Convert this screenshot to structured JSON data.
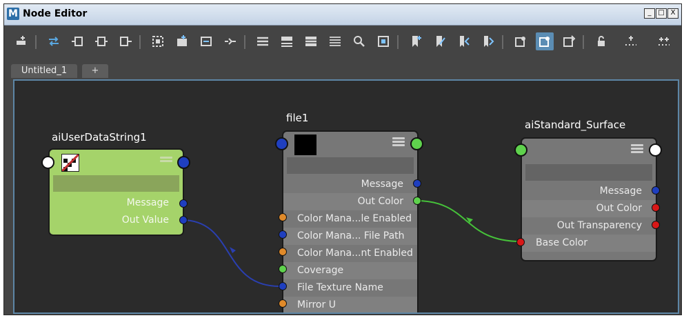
{
  "window": {
    "title": "Node Editor",
    "app_icon_letter": "M",
    "controls": [
      "_",
      "□",
      "X"
    ]
  },
  "tabs": [
    {
      "label": "Untitled_1"
    },
    {
      "label": "+"
    }
  ],
  "toolbar_icons": [
    "add-node-icon",
    "swap-icon",
    "input-connections-icon",
    "io-connections-icon",
    "output-connections-icon",
    "frame-all-icon",
    "frame-selection-icon",
    "clear-graph-icon",
    "layout-icon",
    "simple-mode-icon",
    "connected-mode-icon",
    "full-mode-icon",
    "custom-mode-icon",
    "search-icon",
    "snapshot-icon",
    "bookmark-add-icon",
    "bookmark-edit-icon",
    "bookmark-prev-icon",
    "bookmark-next-icon",
    "graph-settings-icon",
    "graph-settings-active-icon",
    "toggle-attr-icon",
    "lock-icon",
    "grid-icon",
    "snap-grid-icon"
  ],
  "nodes": {
    "user_data": {
      "title": "aiUserDataString1",
      "rows": [
        "Message",
        "Out Value"
      ]
    },
    "file": {
      "title": "file1",
      "rows": [
        "Message",
        "Out Color",
        "Color Mana...le Enabled",
        "Color Mana... File Path",
        "Color Mana...nt Enabled",
        "Coverage",
        "File Texture Name",
        "Mirror U"
      ]
    },
    "shader": {
      "title": "aiStandard_Surface",
      "rows": [
        "Message",
        "Out Color",
        "Out Transparency",
        "Base Color"
      ]
    }
  },
  "colors": {
    "canvas_bg": "#2b2b2b",
    "node_green": "#a5d36a",
    "node_gray": "#777777",
    "port_blue": "#1f3fbf",
    "port_green": "#5fd24d",
    "port_orange": "#e08a2a",
    "port_red": "#d81818",
    "port_white": "#ffffff",
    "conn_blue": "#2a3fb0",
    "conn_green": "#46c23a"
  }
}
